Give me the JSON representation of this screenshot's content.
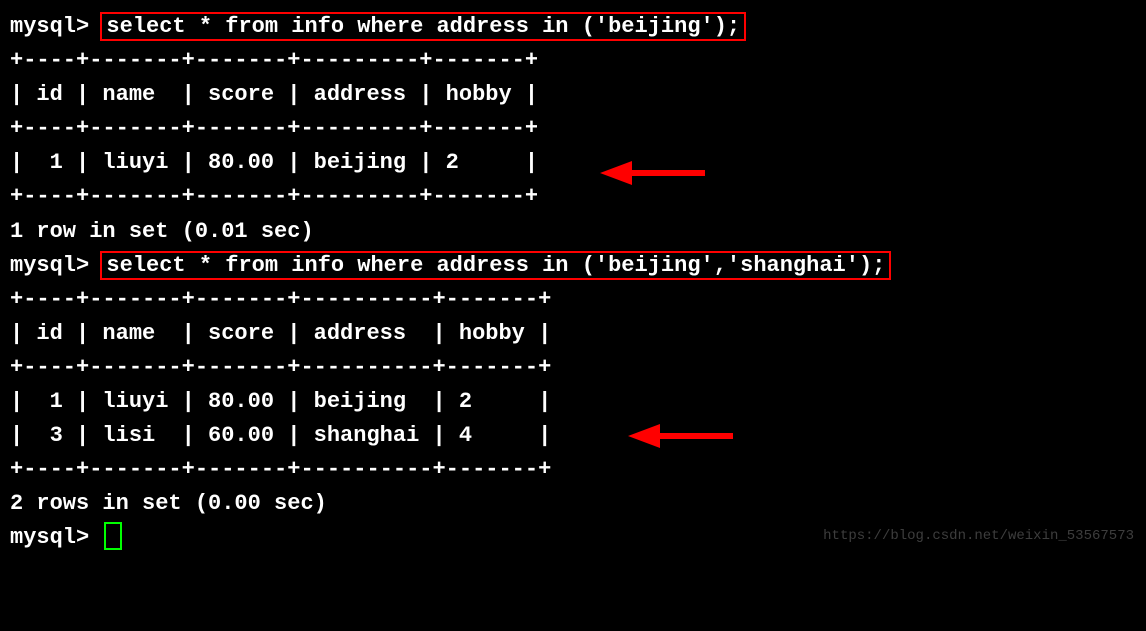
{
  "prompt_label": "mysql> ",
  "query1": {
    "sql": "select * from info where address in ('beijing');",
    "border_top": "+----+-------+-------+---------+-------+",
    "header_row": "| id | name  | score | address | hobby |",
    "border_mid": "+----+-------+-------+---------+-------+",
    "data_rows": [
      "|  1 | liuyi | 80.00 | beijing | 2     |"
    ],
    "border_bot": "+----+-------+-------+---------+-------+",
    "status": "1 row in set (0.01 sec)"
  },
  "query2": {
    "sql": "select * from info where address in ('beijing','shanghai');",
    "border_top": "+----+-------+-------+----------+-------+",
    "header_row": "| id | name  | score | address  | hobby |",
    "border_mid": "+----+-------+-------+----------+-------+",
    "data_rows": [
      "|  1 | liuyi | 80.00 | beijing  | 2     |",
      "|  3 | lisi  | 60.00 | shanghai | 4     |"
    ],
    "border_bot": "+----+-------+-------+----------+-------+",
    "status": "2 rows in set (0.00 sec)"
  },
  "blank_line": "",
  "watermark": "https://blog.csdn.net/weixin_53567573"
}
